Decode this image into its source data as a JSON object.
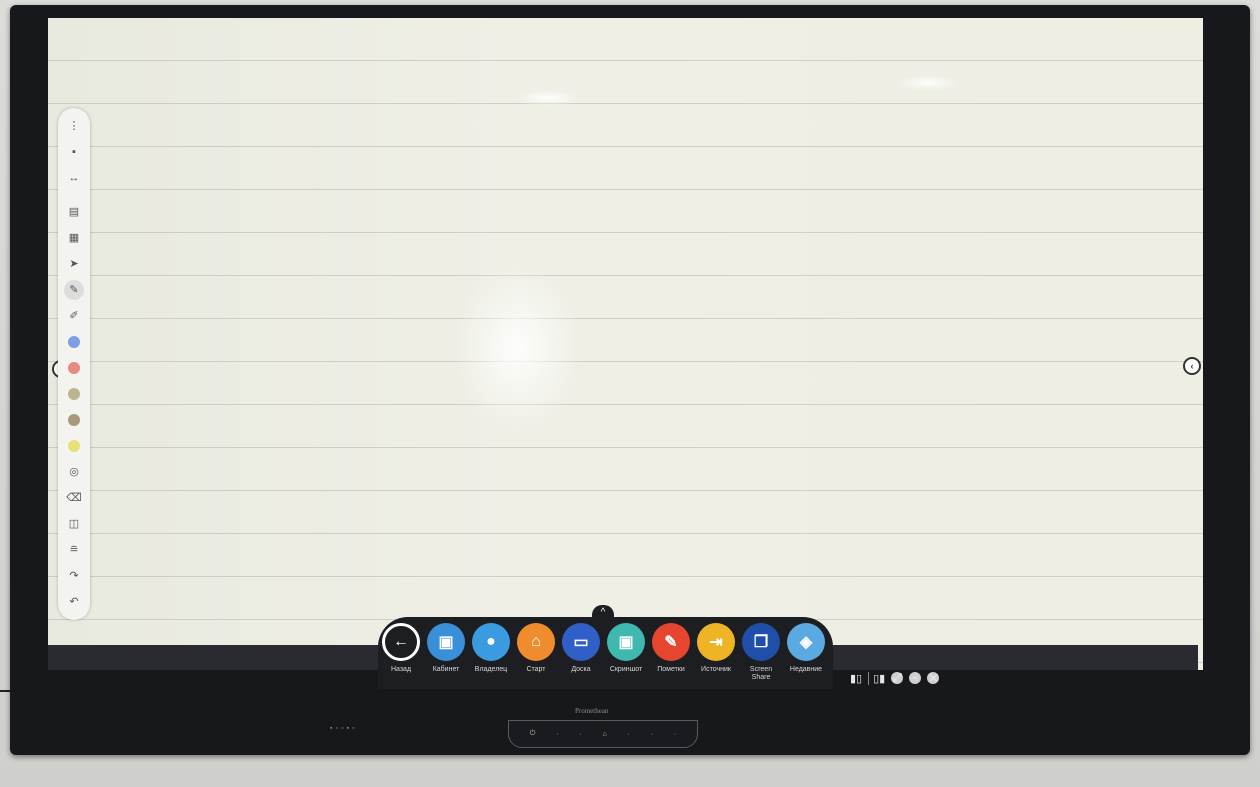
{
  "left_toolbar": {
    "tools": [
      {
        "name": "more-menu-icon",
        "glyph": "⋮"
      },
      {
        "name": "save-icon",
        "glyph": "▪"
      },
      {
        "name": "fit-width-icon",
        "glyph": "↔"
      },
      {
        "name": "pages-icon",
        "glyph": "▤"
      },
      {
        "name": "page-add-icon",
        "glyph": "▦"
      },
      {
        "name": "select-pointer-icon",
        "glyph": "➤"
      },
      {
        "name": "pen-icon",
        "glyph": "✎"
      },
      {
        "name": "highlighter-icon",
        "glyph": "✐"
      }
    ],
    "colors": [
      "#7f9de4",
      "#e88a80",
      "#b9b690",
      "#a89a79",
      "#e8e17a"
    ],
    "tools_bottom": [
      {
        "name": "color-picker-icon",
        "glyph": "◎"
      },
      {
        "name": "eraser-icon",
        "glyph": "⌫"
      },
      {
        "name": "shapes-icon",
        "glyph": "◫"
      },
      {
        "name": "layers-icon",
        "glyph": "≘"
      },
      {
        "name": "redo-icon",
        "glyph": "↷"
      },
      {
        "name": "undo-icon",
        "glyph": "↶"
      }
    ]
  },
  "dock": {
    "items": [
      {
        "label": "Назад",
        "color": "#1d1e22",
        "glyph": "←",
        "name": "back-icon"
      },
      {
        "label": "Кабинет",
        "color": "#3a8fd9",
        "glyph": "▣",
        "name": "cabinet-icon"
      },
      {
        "label": "Владелец",
        "color": "#3a9be0",
        "glyph": "●",
        "name": "owner-icon"
      },
      {
        "label": "Старт",
        "color": "#ef8d2e",
        "glyph": "⌂",
        "name": "home-icon"
      },
      {
        "label": "Доска",
        "color": "#2f5fc7",
        "glyph": "▭",
        "name": "whiteboard-icon"
      },
      {
        "label": "Скриншот",
        "color": "#3fb8b0",
        "glyph": "▣",
        "name": "screenshot-icon"
      },
      {
        "label": "Пометки",
        "color": "#e6452f",
        "glyph": "✎",
        "name": "annotate-icon"
      },
      {
        "label": "Источник",
        "color": "#efb425",
        "glyph": "⇥",
        "name": "source-icon"
      },
      {
        "label": "Screen Share",
        "color": "#1f4fa8",
        "glyph": "❐",
        "name": "screen-share-icon"
      },
      {
        "label": "Недавние",
        "color": "#5aa9e0",
        "glyph": "◈",
        "name": "recent-icon"
      }
    ]
  },
  "tray": {
    "items": [
      {
        "name": "split-left-icon",
        "glyph": "▮▯"
      },
      {
        "name": "split-right-icon",
        "glyph": "▯▮"
      },
      {
        "name": "fullscreen-icon",
        "glyph": "⤢"
      },
      {
        "name": "minimize-icon",
        "glyph": "–"
      },
      {
        "name": "close-icon",
        "glyph": "✕"
      }
    ]
  },
  "hardware": {
    "brand": "Promethean"
  }
}
